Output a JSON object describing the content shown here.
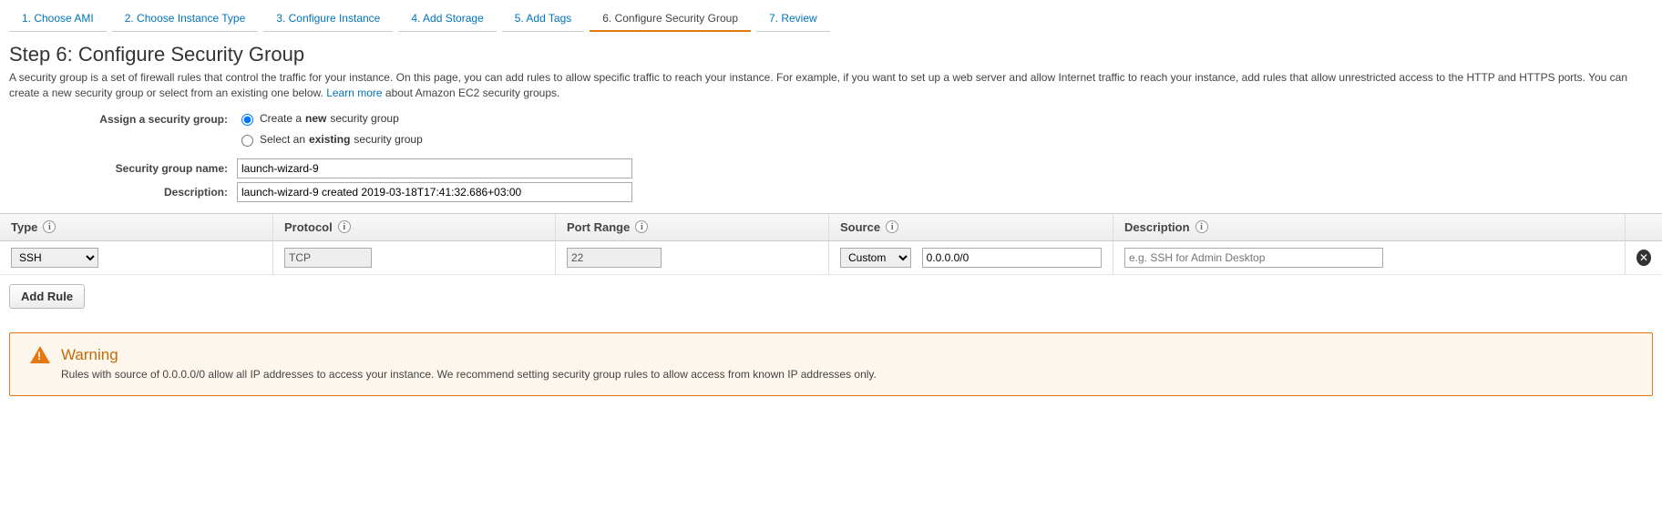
{
  "tabs": [
    {
      "label": "1. Choose AMI"
    },
    {
      "label": "2. Choose Instance Type"
    },
    {
      "label": "3. Configure Instance"
    },
    {
      "label": "4. Add Storage"
    },
    {
      "label": "5. Add Tags"
    },
    {
      "label": "6. Configure Security Group"
    },
    {
      "label": "7. Review"
    }
  ],
  "heading": "Step 6: Configure Security Group",
  "intro_a": "A security group is a set of firewall rules that control the traffic for your instance. On this page, you can add rules to allow specific traffic to reach your instance. For example, if you want to set up a web server and allow Internet traffic to reach your instance, add rules that allow unrestricted access to the HTTP and HTTPS ports. You can create a new security group or select from an existing one below. ",
  "learn_more": "Learn more",
  "intro_b": " about Amazon EC2 security groups.",
  "assign_label": "Assign a security group:",
  "radio_create_a": "Create a ",
  "radio_create_b": "new",
  "radio_create_c": " security group",
  "radio_select_a": "Select an ",
  "radio_select_b": "existing",
  "radio_select_c": " security group",
  "sg_name_label": "Security group name:",
  "sg_name_value": "launch-wizard-9",
  "sg_desc_label": "Description:",
  "sg_desc_value": "launch-wizard-9 created 2019-03-18T17:41:32.686+03:00",
  "cols": {
    "type": "Type",
    "protocol": "Protocol",
    "port": "Port Range",
    "source": "Source",
    "desc": "Description"
  },
  "row": {
    "type": "SSH",
    "protocol": "TCP",
    "port": "22",
    "source_mode": "Custom",
    "source_cidr": "0.0.0.0/0",
    "desc_placeholder": "e.g. SSH for Admin Desktop"
  },
  "add_rule": "Add Rule",
  "warning": {
    "title": "Warning",
    "text": "Rules with source of 0.0.0.0/0 allow all IP addresses to access your instance. We recommend setting security group rules to allow access from known IP addresses only."
  }
}
